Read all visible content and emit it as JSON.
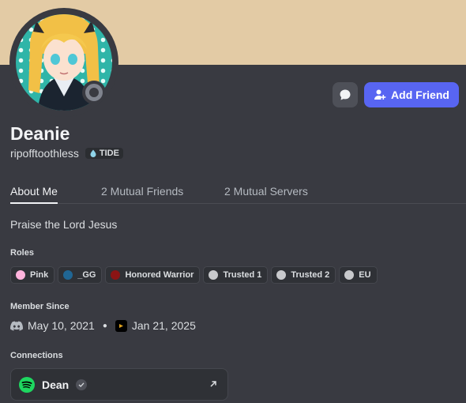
{
  "profile": {
    "display_name": "Deanie",
    "username": "ripofftoothless",
    "guild_tag": "TIDE",
    "status": "offline"
  },
  "actions": {
    "message_icon": "chat-bubble-icon",
    "add_friend_label": "Add Friend"
  },
  "tabs": [
    {
      "label": "About Me",
      "active": true
    },
    {
      "label": "2 Mutual Friends",
      "active": false
    },
    {
      "label": "2 Mutual Servers",
      "active": false
    }
  ],
  "about": {
    "bio": "Praise the Lord Jesus"
  },
  "roles": {
    "title": "Roles",
    "items": [
      {
        "name": "Pink",
        "color": "#ffb3dc"
      },
      {
        "name": "_GG",
        "color": "#206694"
      },
      {
        "name": "Honored Warrior",
        "color": "#8b1414"
      },
      {
        "name": "Trusted 1",
        "color": "#c8c9cc"
      },
      {
        "name": "Trusted 2",
        "color": "#c8c9cc"
      },
      {
        "name": "EU",
        "color": "#c8c9cc"
      }
    ]
  },
  "member_since": {
    "title": "Member Since",
    "discord_date": "May 10, 2021",
    "server_date": "Jan 21, 2025"
  },
  "connections": {
    "title": "Connections",
    "items": [
      {
        "service": "spotify",
        "name": "Dean",
        "verified": true
      }
    ]
  },
  "colors": {
    "banner": "#e3cba5",
    "background": "#393a41",
    "accent": "#5865f2",
    "spotify": "#1ed760"
  }
}
